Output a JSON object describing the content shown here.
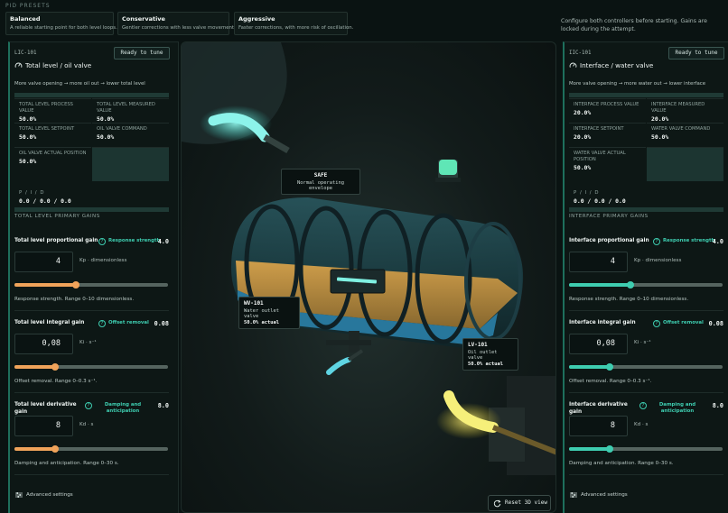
{
  "presets": {
    "title": "PID PRESETS",
    "items": [
      {
        "name": "Balanced",
        "desc": "A reliable starting point for both level loops."
      },
      {
        "name": "Conservative",
        "desc": "Gentler corrections with less valve movement."
      },
      {
        "name": "Aggressive",
        "desc": "Faster corrections, with more risk of oscillation."
      }
    ],
    "note": "Configure both controllers before starting. Gains are locked during the attempt."
  },
  "left": {
    "tag": "LIC-101",
    "status": "Ready to tune",
    "title": "Total level / oil valve",
    "hint": "More valve opening → more oil out → lower total level",
    "cells": [
      {
        "label": "TOTAL LEVEL PROCESS VALUE",
        "value": "50.0%"
      },
      {
        "label": "TOTAL LEVEL MEASURED VALUE",
        "value": "50.0%"
      },
      {
        "label": "TOTAL LEVEL SETPOINT",
        "value": "50.0%"
      },
      {
        "label": "OIL VALVE COMMAND",
        "value": "50.0%"
      },
      {
        "label": "OIL VALVE ACTUAL POSITION",
        "value": "50.0%"
      }
    ],
    "pid_label": "P / I / D",
    "pid_value": "0.0 / 0.0 / 0.0",
    "primary": "TOTAL LEVEL PRIMARY GAINS",
    "gains": [
      {
        "name": "Total level proportional gain",
        "kind": "Response strength",
        "value": "4.0",
        "input": "4",
        "unit": "Kp · dimensionless",
        "range": "Response strength. Range 0–10 dimensionless.",
        "fraction": 0.4
      },
      {
        "name": "Total level integral gain",
        "kind": "Offset removal",
        "value": "0.08",
        "input": "0,08",
        "unit": "Ki · s⁻¹",
        "range": "Offset removal. Range 0–0.3 s⁻¹.",
        "fraction": 0.267
      },
      {
        "name": "Total level derivative gain",
        "kind": "Damping and anticipation",
        "value": "8.0",
        "input": "8",
        "unit": "Kd · s",
        "range": "Damping and anticipation. Range 0–30 s.",
        "fraction": 0.267
      }
    ],
    "advanced": "Advanced settings",
    "color": "#f0a35a"
  },
  "right": {
    "tag": "IIC-101",
    "status": "Ready to tune",
    "title": "Interface / water valve",
    "hint": "More valve opening → more water out → lower interface",
    "cells": [
      {
        "label": "INTERFACE PROCESS VALUE",
        "value": "20.0%"
      },
      {
        "label": "INTERFACE MEASURED VALUE",
        "value": "20.0%"
      },
      {
        "label": "INTERFACE SETPOINT",
        "value": "20.0%"
      },
      {
        "label": "WATER VALVE COMMAND",
        "value": "50.0%"
      },
      {
        "label": "WATER VALVE ACTUAL POSITION",
        "value": "50.0%"
      }
    ],
    "pid_label": "P / I / D",
    "pid_value": "0.0 / 0.0 / 0.0",
    "primary": "INTERFACE PRIMARY GAINS",
    "gains": [
      {
        "name": "Interface proportional gain",
        "kind": "Response strength",
        "value": "4.0",
        "input": "4",
        "unit": "Kp · dimensionless",
        "range": "Response strength. Range 0–10 dimensionless.",
        "fraction": 0.4
      },
      {
        "name": "Interface integral gain",
        "kind": "Offset removal",
        "value": "0.08",
        "input": "0,08",
        "unit": "Ki · s⁻¹",
        "range": "Offset removal. Range 0–0.3 s⁻¹.",
        "fraction": 0.267
      },
      {
        "name": "Interface derivative gain",
        "kind": "Damping and anticipation",
        "value": "8.0",
        "input": "8",
        "unit": "Kd · s",
        "range": "Damping and anticipation. Range 0–30 s.",
        "fraction": 0.267
      }
    ],
    "advanced": "Advanced settings",
    "color": "#3ecdb0"
  },
  "scene": {
    "safe": {
      "title": "SAFE",
      "desc": "Normal operating envelope"
    },
    "wv": {
      "tag": "WV-101",
      "desc": "Water outlet valve",
      "actual": "50.0% actual"
    },
    "lv": {
      "tag": "LV-101",
      "desc": "Oil outlet valve",
      "actual": "50.0% actual"
    },
    "reset": "Reset 3D view"
  }
}
